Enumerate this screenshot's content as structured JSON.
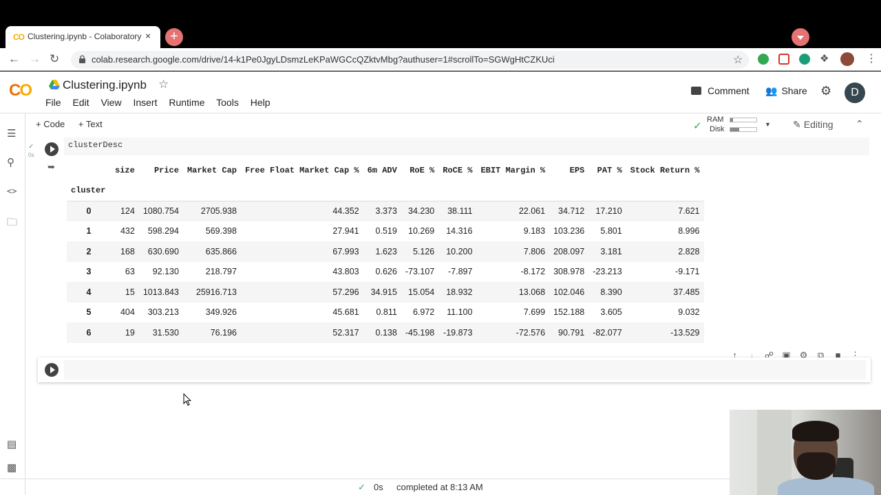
{
  "browser": {
    "tab_title": "Clustering.ipynb - Colaboratory",
    "tab_logo": "CO",
    "tab_close": "×",
    "new_tab": "+",
    "url": "colab.research.google.com/drive/14-k1Pe0JgyLDsmzLeKPaWGCcQZktvMbg?authuser=1#scrollTo=SGWgHtCZKUci"
  },
  "colab": {
    "logo_left": "C",
    "logo_right": "O",
    "notebook_title": "Clustering.ipynb",
    "menu": [
      "File",
      "Edit",
      "View",
      "Insert",
      "Runtime",
      "Tools",
      "Help"
    ],
    "comment_label": "Comment",
    "share_label": "Share",
    "avatar_letter": "D",
    "add_code": "+ Code",
    "add_text": "+ Text",
    "ram_label": "RAM",
    "disk_label": "Disk",
    "editing_label": "Editing"
  },
  "cell": {
    "code": "clusterDesc",
    "exec_time": "0s"
  },
  "dataframe": {
    "index_name": "cluster",
    "columns": [
      "size",
      "Price",
      "Market Cap",
      "Free Float Market Cap %",
      "6m ADV",
      "RoE %",
      "RoCE %",
      "EBIT Margin %",
      "EPS",
      "PAT %",
      "Stock Return %"
    ],
    "rows": [
      {
        "index": "0",
        "values": [
          "124",
          "1080.754",
          "2705.938",
          "44.352",
          "3.373",
          "34.230",
          "38.111",
          "22.061",
          "34.712",
          "17.210",
          "7.621"
        ]
      },
      {
        "index": "1",
        "values": [
          "432",
          "598.294",
          "569.398",
          "27.941",
          "0.519",
          "10.269",
          "14.316",
          "9.183",
          "103.236",
          "5.801",
          "8.996"
        ]
      },
      {
        "index": "2",
        "values": [
          "168",
          "630.690",
          "635.866",
          "67.993",
          "1.623",
          "5.126",
          "10.200",
          "7.806",
          "208.097",
          "3.181",
          "2.828"
        ]
      },
      {
        "index": "3",
        "values": [
          "63",
          "92.130",
          "218.797",
          "43.803",
          "0.626",
          "-73.107",
          "-7.897",
          "-8.172",
          "308.978",
          "-23.213",
          "-9.171"
        ]
      },
      {
        "index": "4",
        "values": [
          "15",
          "1013.843",
          "25916.713",
          "57.296",
          "34.915",
          "15.054",
          "18.932",
          "13.068",
          "102.046",
          "8.390",
          "37.485"
        ]
      },
      {
        "index": "5",
        "values": [
          "404",
          "303.213",
          "349.926",
          "45.681",
          "0.811",
          "6.972",
          "11.100",
          "7.699",
          "152.188",
          "3.605",
          "9.032"
        ]
      },
      {
        "index": "6",
        "values": [
          "19",
          "31.530",
          "76.196",
          "52.317",
          "0.138",
          "-45.198",
          "-19.873",
          "-72.576",
          "90.791",
          "-82.077",
          "-13.529"
        ]
      }
    ]
  },
  "status": {
    "elapsed": "0s",
    "message": "completed at 8:13 AM"
  },
  "colors": {
    "colab_orange": "#f9ab00",
    "avatar": "#37474f",
    "check_green": "#4caf50"
  }
}
